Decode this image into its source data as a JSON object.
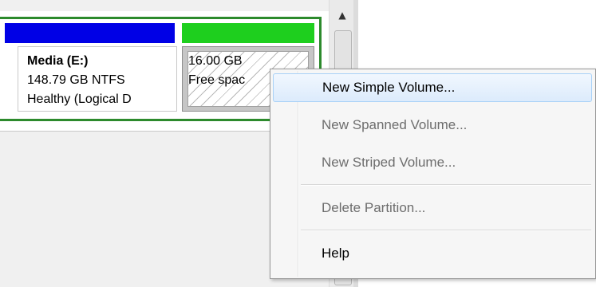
{
  "disk": {
    "volumes": [
      {
        "name": "Media  (E:)",
        "size": "148.79 GB NTFS",
        "status": "Healthy (Logical D"
      },
      {
        "name": "",
        "size": "16.00 GB",
        "status": "Free spac"
      }
    ]
  },
  "context_menu": {
    "items": [
      {
        "label": "New Simple Volume...",
        "enabled": true,
        "highlighted": true
      },
      {
        "label": "New Spanned Volume...",
        "enabled": false
      },
      {
        "label": "New Striped Volume...",
        "enabled": false
      },
      {
        "label": "Delete Partition...",
        "enabled": false
      },
      {
        "label": "Help",
        "enabled": true
      }
    ]
  },
  "scrollbar": {
    "up_arrow": "▲"
  },
  "colors": {
    "primary_partition_bar": "#0000e6",
    "free_space_bar": "#1ecf1e",
    "extended_partition_border": "#2c8a2c",
    "menu_highlight": "#dcebfc"
  }
}
